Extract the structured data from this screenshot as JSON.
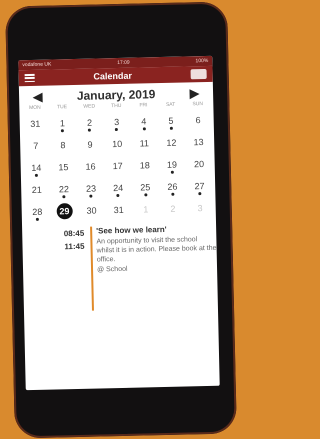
{
  "status": {
    "carrier": "vodafone UK",
    "time": "17:09",
    "battery": "100%"
  },
  "header": {
    "title": "Calendar"
  },
  "calendar": {
    "month_label": "January, 2019",
    "weekdays": [
      "MON",
      "TUE",
      "WED",
      "THU",
      "FRI",
      "SAT",
      "SUN"
    ],
    "days": [
      {
        "n": "31",
        "muted": false,
        "dot": false
      },
      {
        "n": "1",
        "muted": false,
        "dot": true
      },
      {
        "n": "2",
        "muted": false,
        "dot": true
      },
      {
        "n": "3",
        "muted": false,
        "dot": true
      },
      {
        "n": "4",
        "muted": false,
        "dot": true
      },
      {
        "n": "5",
        "muted": false,
        "dot": true
      },
      {
        "n": "6",
        "muted": false,
        "dot": false
      },
      {
        "n": "7",
        "muted": false,
        "dot": false
      },
      {
        "n": "8",
        "muted": false,
        "dot": false
      },
      {
        "n": "9",
        "muted": false,
        "dot": false
      },
      {
        "n": "10",
        "muted": false,
        "dot": false
      },
      {
        "n": "11",
        "muted": false,
        "dot": false
      },
      {
        "n": "12",
        "muted": false,
        "dot": false
      },
      {
        "n": "13",
        "muted": false,
        "dot": false
      },
      {
        "n": "14",
        "muted": false,
        "dot": true
      },
      {
        "n": "15",
        "muted": false,
        "dot": false
      },
      {
        "n": "16",
        "muted": false,
        "dot": false
      },
      {
        "n": "17",
        "muted": false,
        "dot": false
      },
      {
        "n": "18",
        "muted": false,
        "dot": false
      },
      {
        "n": "19",
        "muted": false,
        "dot": true
      },
      {
        "n": "20",
        "muted": false,
        "dot": false
      },
      {
        "n": "21",
        "muted": false,
        "dot": false
      },
      {
        "n": "22",
        "muted": false,
        "dot": true
      },
      {
        "n": "23",
        "muted": false,
        "dot": true
      },
      {
        "n": "24",
        "muted": false,
        "dot": true
      },
      {
        "n": "25",
        "muted": false,
        "dot": true
      },
      {
        "n": "26",
        "muted": false,
        "dot": true
      },
      {
        "n": "27",
        "muted": false,
        "dot": true
      },
      {
        "n": "28",
        "muted": false,
        "dot": true
      },
      {
        "n": "29",
        "muted": false,
        "dot": false,
        "selected": true
      },
      {
        "n": "30",
        "muted": false,
        "dot": false
      },
      {
        "n": "31",
        "muted": false,
        "dot": false
      },
      {
        "n": "1",
        "muted": true,
        "dot": false
      },
      {
        "n": "2",
        "muted": true,
        "dot": false
      },
      {
        "n": "3",
        "muted": true,
        "dot": false
      }
    ]
  },
  "event": {
    "time_start": "08:45",
    "time_end": "11:45",
    "title": "'See how we learn'",
    "description": "An opportunity to visit the school whilst it is in action. Please book at the office.",
    "location": "@ School"
  }
}
